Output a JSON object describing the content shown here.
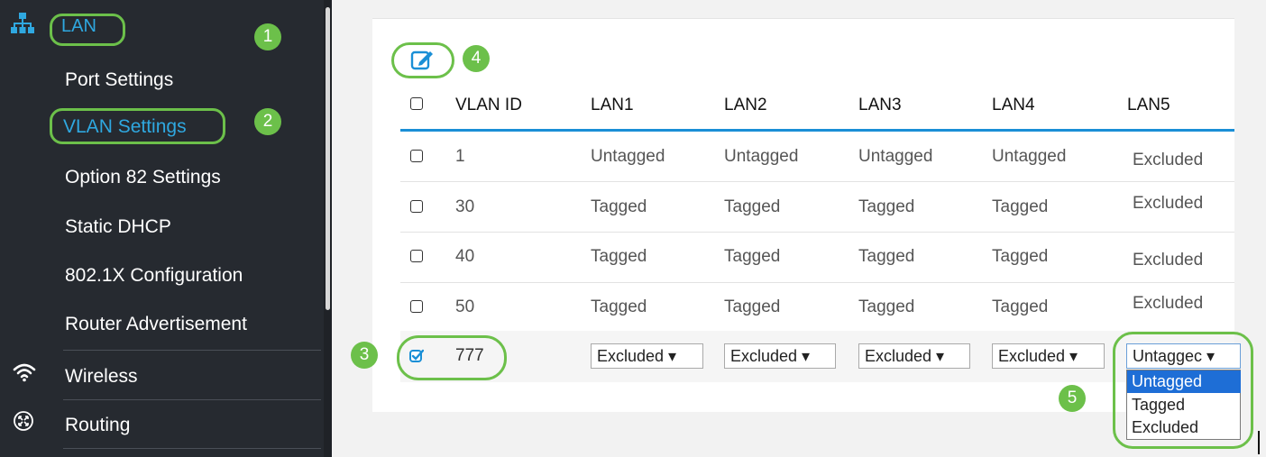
{
  "sidebar": {
    "section_lan": "LAN",
    "items": [
      {
        "label": "Port Settings"
      },
      {
        "label": "VLAN Settings"
      },
      {
        "label": "Option 82 Settings"
      },
      {
        "label": "Static DHCP"
      },
      {
        "label": "802.1X Configuration"
      },
      {
        "label": "Router Advertisement"
      }
    ],
    "section_wireless": "Wireless",
    "section_routing": "Routing"
  },
  "callouts": {
    "one": "1",
    "two": "2",
    "three": "3",
    "four": "4",
    "five": "5"
  },
  "table": {
    "headers": [
      "VLAN ID",
      "LAN1",
      "LAN2",
      "LAN3",
      "LAN4",
      "LAN5"
    ],
    "rows": [
      {
        "vlan": "1",
        "cells": [
          "Untagged",
          "Untagged",
          "Untagged",
          "Untagged",
          "Excluded"
        ],
        "checked": false
      },
      {
        "vlan": "30",
        "cells": [
          "Tagged",
          "Tagged",
          "Tagged",
          "Tagged",
          "Excluded"
        ],
        "checked": false
      },
      {
        "vlan": "40",
        "cells": [
          "Tagged",
          "Tagged",
          "Tagged",
          "Tagged",
          "Excluded"
        ],
        "checked": false
      },
      {
        "vlan": "50",
        "cells": [
          "Tagged",
          "Tagged",
          "Tagged",
          "Tagged",
          "Excluded"
        ],
        "checked": false
      }
    ],
    "edit_row": {
      "vlan": "777",
      "checked": true,
      "selects": [
        "Excluded ▾",
        "Excluded ▾",
        "Excluded ▾",
        "Excluded ▾",
        "Untaggec ▾"
      ],
      "dropdown_options": [
        "Untagged",
        "Tagged",
        "Excluded"
      ],
      "dropdown_highlighted": "Untagged"
    }
  },
  "colors": {
    "sidebar_bg": "#262a30",
    "active": "#2fa8e0",
    "highlight_green": "#6cc04a",
    "accent_blue": "#1a8fd6",
    "option_selected": "#1e6ed6"
  }
}
